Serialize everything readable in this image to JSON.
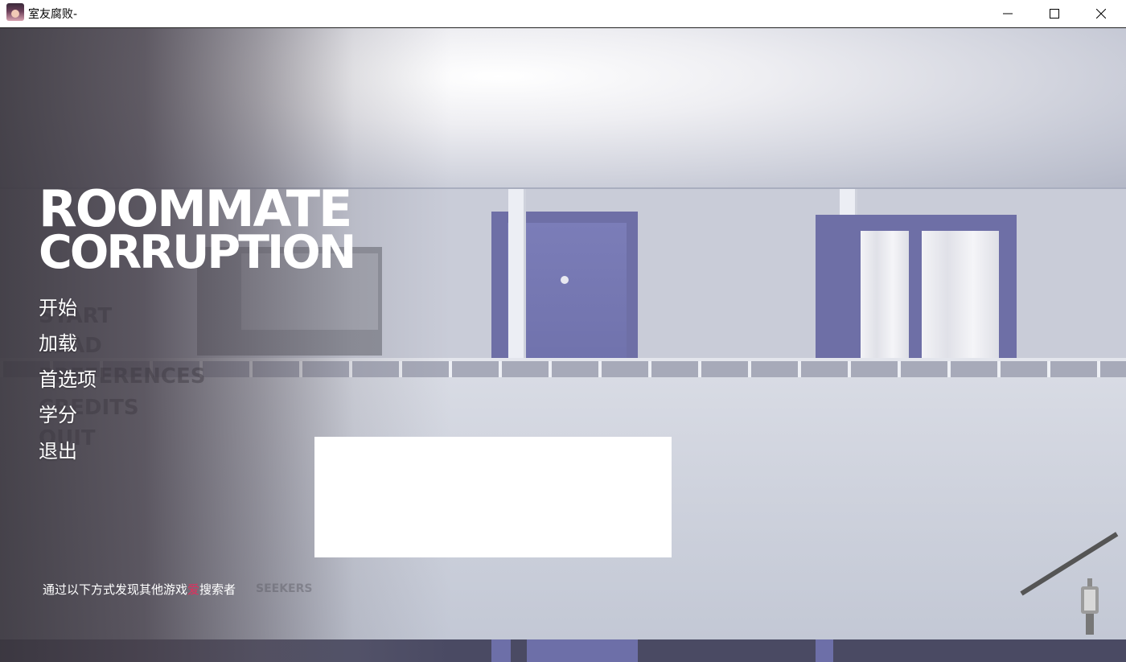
{
  "window": {
    "title": "室友腐败-",
    "icon": "app-portrait-icon",
    "controls": [
      "minimize-icon",
      "maximize-icon",
      "close-icon"
    ]
  },
  "game": {
    "logo": {
      "line1": "ROOMMATE",
      "line2": "CORRUPTION"
    },
    "menu": [
      {
        "label": "开始",
        "ghost": "START"
      },
      {
        "label": "加载",
        "ghost": "LOAD"
      },
      {
        "label": "首选项",
        "ghost": "PREFERENCES"
      },
      {
        "label": "学分",
        "ghost": "CREDITS"
      },
      {
        "label": "退出",
        "ghost": "QUIT"
      }
    ],
    "footer": {
      "prefix": "通过以下方式发现其他游戏",
      "accent": "爱",
      "suffix": "搜索者",
      "ghost": "SEEKERS",
      "accent_color": "#e0305e"
    }
  },
  "colors": {
    "text": "#ffffff",
    "door": "#6f71ab",
    "suitcase": "#1ea2c2"
  }
}
